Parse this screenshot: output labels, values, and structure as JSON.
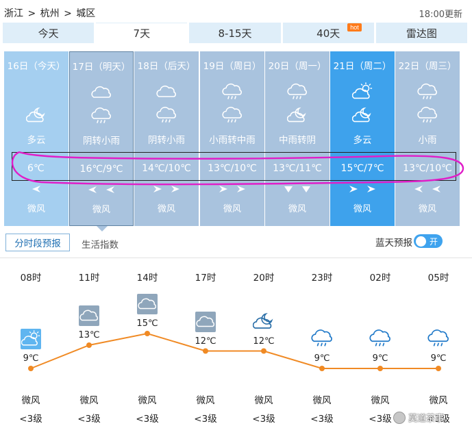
{
  "breadcrumb": [
    "浙江",
    "杭州",
    "城区"
  ],
  "update_time": "18:00更新",
  "tabs": [
    {
      "label": "今天",
      "active": false
    },
    {
      "label": "7天",
      "active": true
    },
    {
      "label": "8-15天",
      "active": false
    },
    {
      "label": "40天",
      "active": false,
      "badge": "hot"
    },
    {
      "label": "雷达图",
      "active": false
    }
  ],
  "days": [
    {
      "date": "16日（今天）",
      "icons": [
        "partly-cloudy-night-icon"
      ],
      "condition": "多云",
      "temp": "6℃",
      "wind": "微风",
      "state": "today"
    },
    {
      "date": "17日（明天）",
      "icons": [
        "cloudy-icon",
        "rain-icon"
      ],
      "condition": "阴转小雨",
      "temp": "16℃/9℃",
      "wind": "微风",
      "state": "selected"
    },
    {
      "date": "18日（后天）",
      "icons": [
        "cloudy-icon",
        "rain-icon"
      ],
      "condition": "阴转小雨",
      "temp": "14℃/10℃",
      "wind": "微风",
      "state": "normal"
    },
    {
      "date": "19日（周日）",
      "icons": [
        "rain-icon",
        "rain-icon"
      ],
      "condition": "小雨转中雨",
      "temp": "13℃/10℃",
      "wind": "微风",
      "state": "normal"
    },
    {
      "date": "20日（周一）",
      "icons": [
        "rain-icon",
        "partly-cloudy-night-icon"
      ],
      "condition": "中雨转阴",
      "temp": "13℃/11℃",
      "wind": "微风",
      "state": "normal"
    },
    {
      "date": "21日（周二）",
      "icons": [
        "partly-cloudy-day-icon",
        "partly-cloudy-night-icon"
      ],
      "condition": "多云",
      "temp": "15℃/7℃",
      "wind": "微风",
      "state": "sunny"
    },
    {
      "date": "22日（周三）",
      "icons": [
        "rain-icon",
        "rain-icon"
      ],
      "condition": "小雨",
      "temp": "13℃/10℃",
      "wind": "微风",
      "state": "normal"
    }
  ],
  "subtabs": {
    "active": "分时段预报",
    "other": "生活指数"
  },
  "blue_sky": {
    "label": "蓝天预报",
    "toggle": "开"
  },
  "hourly": [
    {
      "time": "08时",
      "temp": 9,
      "temp_label": "9℃",
      "icon": "partly-cloudy-day-icon",
      "wind": "微风",
      "level": "<3级"
    },
    {
      "time": "11时",
      "temp": 13,
      "temp_label": "13℃",
      "icon": "cloudy-icon",
      "wind": "微风",
      "level": "<3级"
    },
    {
      "time": "14时",
      "temp": 15,
      "temp_label": "15℃",
      "icon": "cloudy-icon",
      "wind": "微风",
      "level": "<3级"
    },
    {
      "time": "17时",
      "temp": 12,
      "temp_label": "12℃",
      "icon": "cloudy-icon",
      "wind": "微风",
      "level": "<3级"
    },
    {
      "time": "20时",
      "temp": 12,
      "temp_label": "12℃",
      "icon": "partly-cloudy-night-icon",
      "wind": "微风",
      "level": "<3级"
    },
    {
      "time": "23时",
      "temp": 9,
      "temp_label": "9℃",
      "icon": "rain-icon",
      "wind": "微风",
      "level": "<3级"
    },
    {
      "time": "02时",
      "temp": 9,
      "temp_label": "9℃",
      "icon": "rain-icon",
      "wind": "微风",
      "level": "<3级"
    },
    {
      "time": "05时",
      "temp": 9,
      "temp_label": "9℃",
      "icon": "rain-icon",
      "wind": "微风",
      "level": "<3级"
    }
  ],
  "watermark": "莫道茶事",
  "colors": {
    "line": "#f08a24",
    "today": "#a5cff0",
    "normal": "#a9c3de",
    "sunny": "#3ea2ec",
    "annotation": "#e01ec8"
  }
}
